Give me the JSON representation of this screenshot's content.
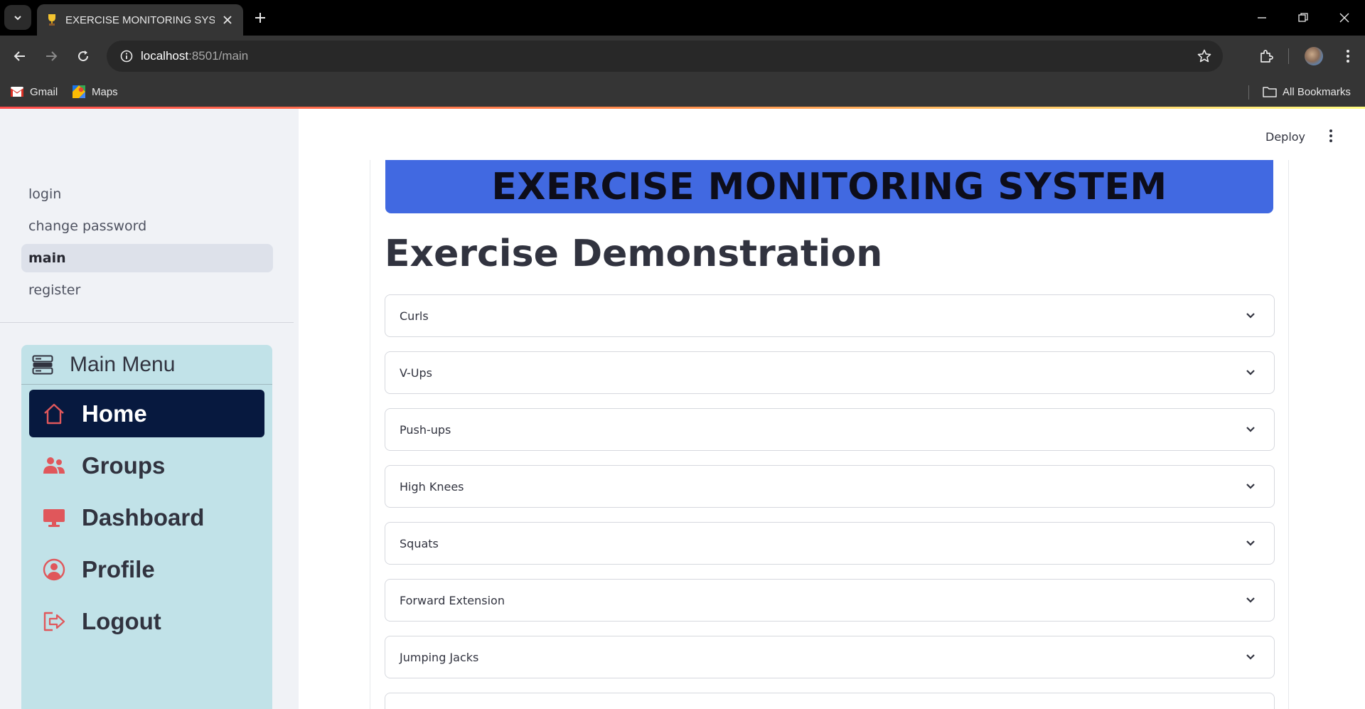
{
  "browser": {
    "tab_title": "EXERCISE MONITORING SYSTEM",
    "url_host": "localhost",
    "url_path": ":8501/main",
    "bookmarks": [
      {
        "label": "Gmail",
        "icon": "gmail-icon"
      },
      {
        "label": "Maps",
        "icon": "maps-icon"
      }
    ],
    "all_bookmarks": "All Bookmarks"
  },
  "sidebar": {
    "pages": [
      {
        "label": "login",
        "active": false
      },
      {
        "label": "change password",
        "active": false
      },
      {
        "label": "main",
        "active": true
      },
      {
        "label": "register",
        "active": false
      }
    ],
    "menu": {
      "title": "Main Menu",
      "items": [
        {
          "label": "Home",
          "icon": "house-icon",
          "selected": true
        },
        {
          "label": "Groups",
          "icon": "people-icon",
          "selected": false
        },
        {
          "label": "Dashboard",
          "icon": "display-icon",
          "selected": false
        },
        {
          "label": "Profile",
          "icon": "person-circle-icon",
          "selected": false
        },
        {
          "label": "Logout",
          "icon": "logout-icon",
          "selected": false
        }
      ],
      "icon_color": "#e0575b",
      "selected_bg": "#07193f",
      "box_bg": "#c1e2e8"
    }
  },
  "main": {
    "deploy_label": "Deploy",
    "banner_title": "EXERCISE MONITORING SYSTEM",
    "banner_color": "#4169e1",
    "heading": "Exercise Demonstration",
    "exercises": [
      "Curls",
      "V-Ups",
      "Push-ups",
      "High Knees",
      "Squats",
      "Forward Extension",
      "Jumping Jacks"
    ]
  }
}
